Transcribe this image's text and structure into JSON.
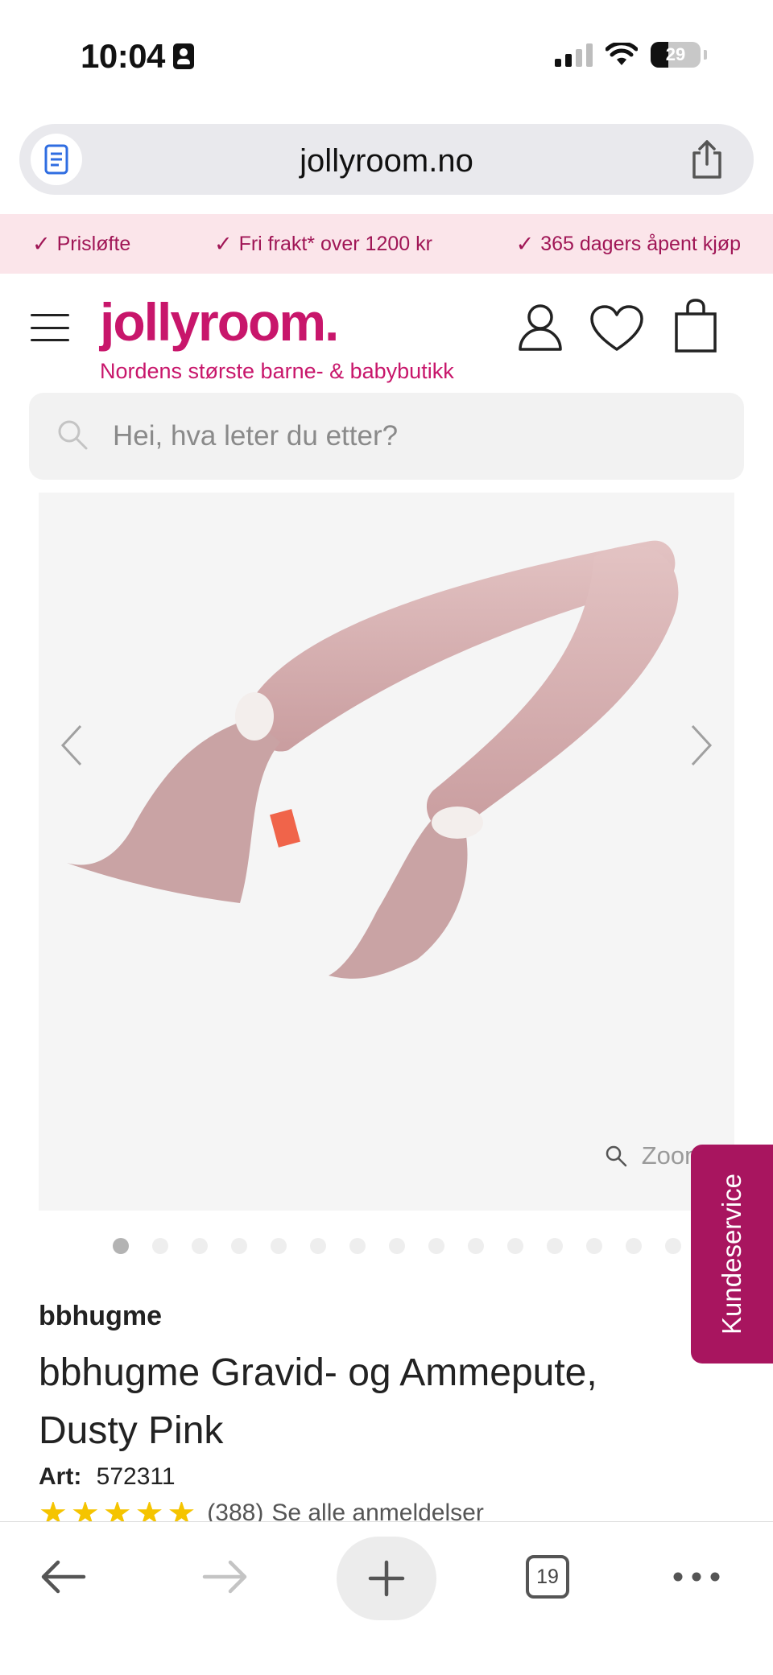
{
  "status_bar": {
    "time": "10:04",
    "battery_level": "29",
    "battery_fraction": 0.29
  },
  "browser": {
    "url": "jollyroom.no"
  },
  "promo": [
    {
      "check": "✓",
      "label": "Prisløfte"
    },
    {
      "check": "✓",
      "label": "Fri frakt* over 1200 kr"
    },
    {
      "check": "✓",
      "label": "365 dagers åpent kjøp"
    }
  ],
  "header": {
    "logo": "jollyroom.",
    "tagline": "Nordens største barne- & babybutikk"
  },
  "search": {
    "placeholder": "Hei, hva leter du etter?"
  },
  "gallery": {
    "zoom_label": "Zoom",
    "dot_count": 15,
    "active_index": 0
  },
  "kundeservice_label": "Kundeservice",
  "product": {
    "brand": "bbhugme",
    "title": "bbhugme Gravid- og Ammepute, Dusty Pink",
    "art_label": "Art:",
    "art_number": "572311",
    "stars": "★★★★★",
    "rating_value": 5,
    "review_count": "(388)",
    "reviews_link": "Se alle anmeldelser"
  },
  "toolbar": {
    "tabs_count": "19"
  },
  "colors": {
    "brand": "#c8166b",
    "promo_bg": "#fbe5ea",
    "kundeservice_bg": "#a8155f",
    "star": "#f5c400"
  }
}
